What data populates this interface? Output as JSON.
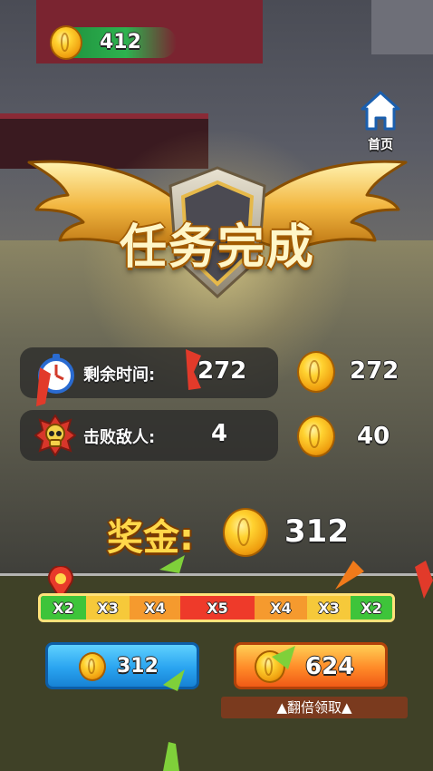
{
  "hud": {
    "coins": "412"
  },
  "home": {
    "label": "首页"
  },
  "banner": {
    "title": "任务完成"
  },
  "rows": [
    {
      "label": "剩余时间:",
      "value": "272",
      "reward": "272",
      "icon": "stopwatch-icon"
    },
    {
      "label": "击败敌人:",
      "value": "4",
      "reward": "40",
      "icon": "skull-icon"
    }
  ],
  "reward": {
    "label": "奖金:",
    "amount": "312"
  },
  "multiplier": {
    "segments": [
      "X2",
      "X3",
      "X4",
      "X5",
      "X4",
      "X3",
      "X2"
    ],
    "colors": [
      "#3ec43a",
      "#f6c93a",
      "#f59a2e",
      "#ee3a2a",
      "#f59a2e",
      "#f6c93a",
      "#3ec43a"
    ]
  },
  "buttons": {
    "claim_amount": "312",
    "double_amount": "624",
    "double_label": "▲翻倍领取▲"
  },
  "colors": {
    "accent_gold": "#ffd84a",
    "button_blue": "#2aa4f0",
    "button_orange": "#ff8a28"
  }
}
